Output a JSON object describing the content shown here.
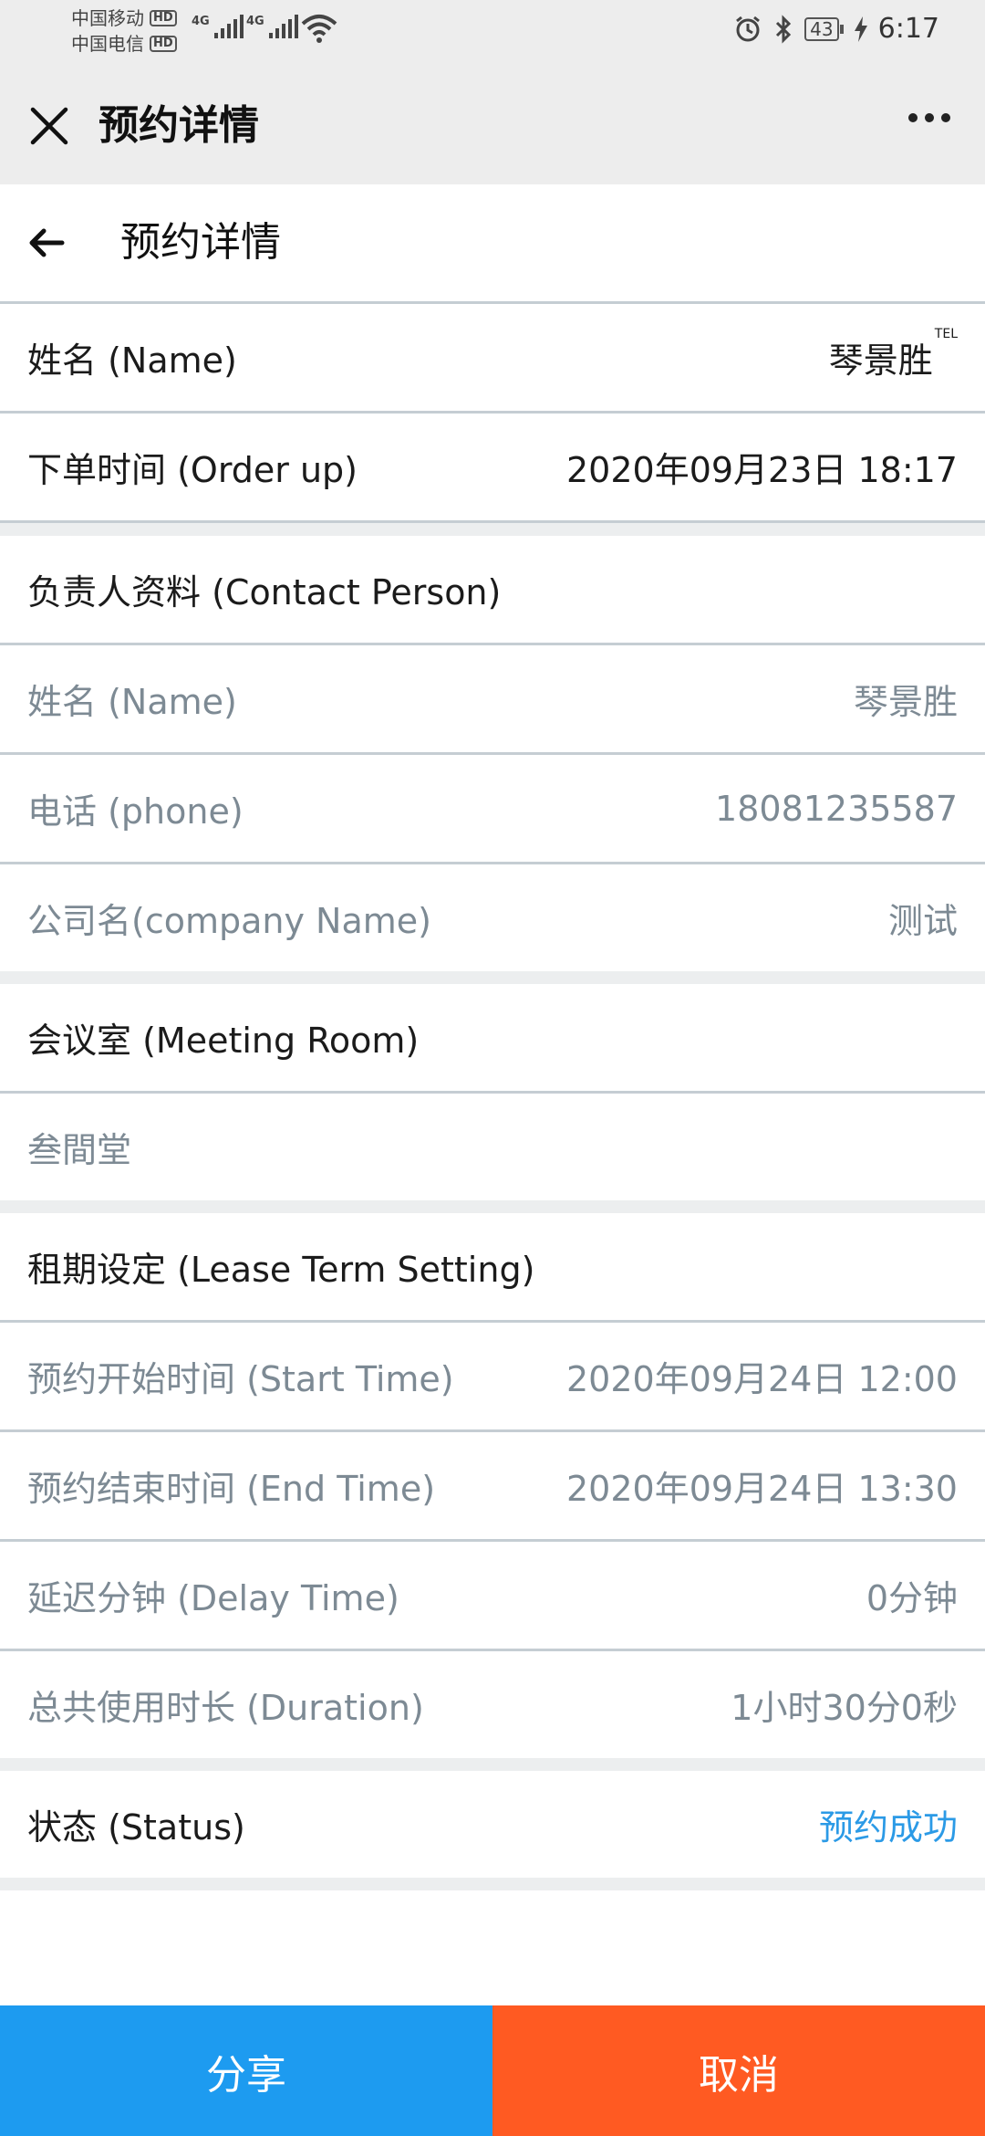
{
  "status_bar": {
    "carrier1": "中国移动",
    "carrier2": "中国电信",
    "hd": "HD",
    "net": "4G",
    "battery": "43",
    "time": "6:17"
  },
  "wechat_header": {
    "title": "预约详情",
    "close_icon": "close-icon",
    "more_icon": "more-dots-icon"
  },
  "page_bar": {
    "title": "预约详情",
    "back_icon": "arrow-left-icon"
  },
  "rows": {
    "name": {
      "label": "姓名 (Name)",
      "value": "琴景胜",
      "badge": "TEL"
    },
    "order_time": {
      "label": "下单时间 (Order up)",
      "value": "2020年09月23日 18:17"
    }
  },
  "contact": {
    "section": "负责人资料 (Contact Person)",
    "name_label": "姓名 (Name)",
    "name_value": "琴景胜",
    "phone_label": "电话 (phone)",
    "phone_value": "18081235587",
    "company_label": "公司名(company Name)",
    "company_value": "测试"
  },
  "meeting": {
    "section": "会议室 (Meeting Room)",
    "room": "叁間堂"
  },
  "lease": {
    "section": "租期设定 (Lease Term Setting)",
    "start_label": "预约开始时间 (Start Time)",
    "start_value": "2020年09月24日 12:00",
    "end_label": "预约结束时间 (End Time)",
    "end_value": "2020年09月24日 13:30",
    "delay_label": "延迟分钟 (Delay Time)",
    "delay_value": "0分钟",
    "duration_label": "总共使用时长 (Duration)",
    "duration_value": "1小时30分0秒"
  },
  "status": {
    "label": "状态 (Status)",
    "value": "预约成功",
    "color": "#2b9ae6"
  },
  "buttons": {
    "share": "分享",
    "cancel": "取消",
    "share_color": "#1d9bf0",
    "cancel_color": "#ff5a22"
  }
}
